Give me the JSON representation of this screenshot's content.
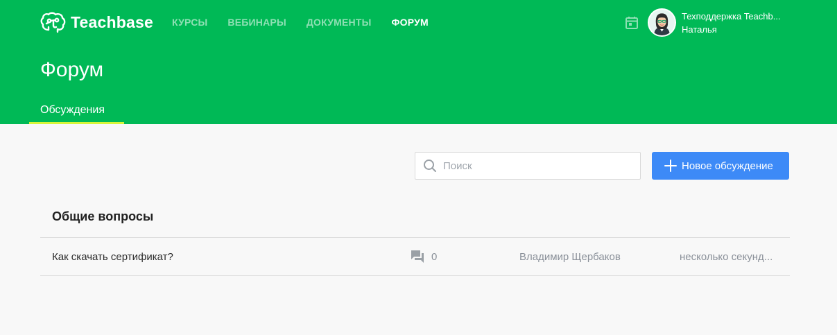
{
  "brand": {
    "name": "Teachbase",
    "logo_icon": "brain-icon"
  },
  "nav": {
    "items": [
      {
        "label": "КУРСЫ",
        "active": false
      },
      {
        "label": "ВЕБИНАРЫ",
        "active": false
      },
      {
        "label": "ДОКУМЕНТЫ",
        "active": false
      },
      {
        "label": "ФОРУМ",
        "active": true
      }
    ]
  },
  "header": {
    "calendar_icon": "calendar-icon",
    "user": {
      "name": "Техподдержка Teachb...",
      "subtitle": "Наталья"
    }
  },
  "page": {
    "title": "Форум",
    "tabs": [
      {
        "label": "Обсуждения",
        "active": true
      }
    ]
  },
  "toolbar": {
    "search_placeholder": "Поиск",
    "new_button_label": "Новое обсуждение"
  },
  "section": {
    "title": "Общие вопросы",
    "topics": [
      {
        "title": "Как скачать сертификат?",
        "comments": "0",
        "author": "Владимир Щербаков",
        "time": "несколько секунд..."
      }
    ]
  },
  "colors": {
    "header_bg": "#00b956",
    "nav_inactive": "#8fe0b4",
    "tab_underline": "#d7f53a",
    "primary_button": "#3d8af7",
    "page_bg": "#f8f8f8",
    "muted_text": "#8a9099"
  }
}
